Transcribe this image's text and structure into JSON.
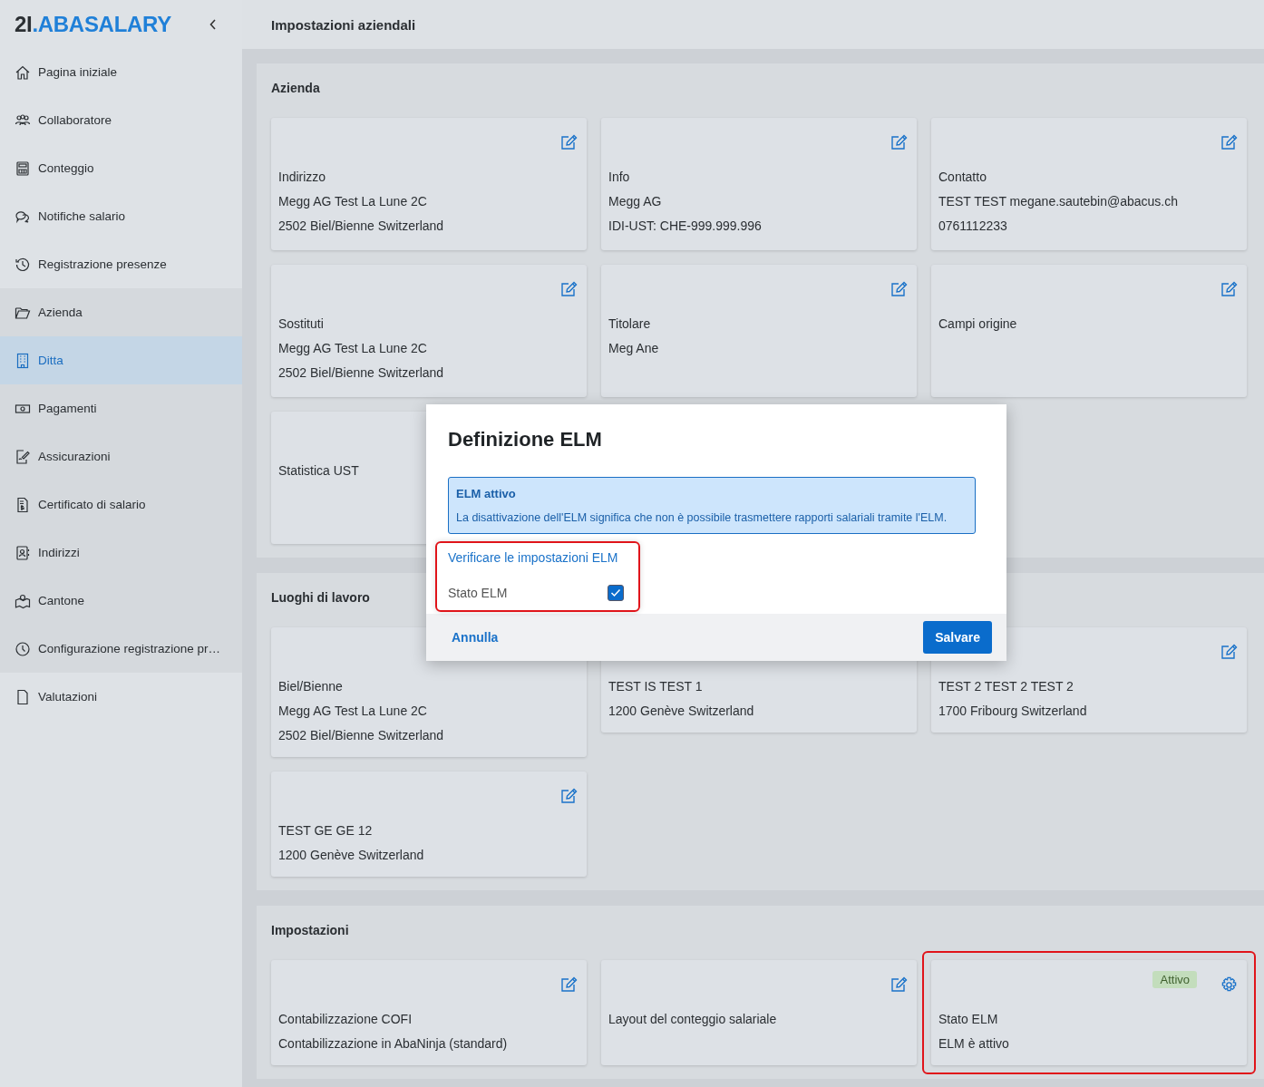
{
  "sidebar": {
    "logo": {
      "mark": "2I",
      "dot": ".",
      "name": "ABASALARY"
    },
    "items": [
      {
        "label": "Pagina iniziale",
        "selected": false
      },
      {
        "label": "Collaboratore",
        "selected": false
      },
      {
        "label": "Conteggio",
        "selected": false
      },
      {
        "label": "Notifiche salario",
        "selected": false
      },
      {
        "label": "Registrazione presenze",
        "selected": false
      },
      {
        "label": "Azienda",
        "selected": false,
        "expanded": true,
        "children": [
          {
            "label": "Ditta",
            "selected": true
          },
          {
            "label": "Pagamenti",
            "selected": false
          },
          {
            "label": "Assicurazioni",
            "selected": false
          },
          {
            "label": "Certificato di salario",
            "selected": false
          },
          {
            "label": "Indirizzi",
            "selected": false
          },
          {
            "label": "Cantone",
            "selected": false
          },
          {
            "label": "Configurazione registrazione pr…",
            "selected": false
          }
        ]
      },
      {
        "label": "Valutazioni",
        "selected": false
      }
    ]
  },
  "header": {
    "title": "Impostazioni aziendali"
  },
  "sections": [
    {
      "title": "Azienda",
      "cards": [
        {
          "kind": "editable",
          "lines": [
            "Indirizzo",
            "Megg AG Test  La Lune 2C",
            "2502 Biel/Bienne  Switzerland"
          ]
        },
        {
          "kind": "editable",
          "lines": [
            "Info",
            "Megg AG",
            "IDI-UST: CHE-999.999.996"
          ]
        },
        {
          "kind": "editable",
          "lines": [
            "Contatto",
            "TEST TEST  megane.sautebin@abacus.ch",
            "0761112233"
          ]
        },
        {
          "kind": "editable",
          "lines": [
            "Sostituti",
            "Megg AG Test  La Lune 2C",
            "2502 Biel/Bienne  Switzerland"
          ]
        },
        {
          "kind": "editable",
          "lines": [
            "Titolare",
            "Meg Ane"
          ]
        },
        {
          "kind": "editable",
          "lines": [
            "Campi origine"
          ]
        },
        {
          "kind": "plain",
          "lines": [
            "Statistica UST"
          ]
        }
      ]
    },
    {
      "title": "Luoghi di lavoro",
      "cards": [
        {
          "kind": "plain",
          "lines": [
            "Biel/Bienne",
            "Megg AG Test  La Lune 2C",
            "2502 Biel/Bienne  Switzerland"
          ]
        },
        {
          "kind": "plain",
          "lines": [
            "TEST IS  TEST 1",
            "1200 Genève  Switzerland"
          ]
        },
        {
          "kind": "editable",
          "lines": [
            "TEST 2  TEST 2 TEST 2",
            "1700 Fribourg  Switzerland"
          ]
        },
        {
          "kind": "editable",
          "lines": [
            "TEST GE  GE 12",
            "1200 Genève  Switzerland"
          ]
        }
      ]
    },
    {
      "title": "Impostazioni",
      "cards": [
        {
          "kind": "editable",
          "lines": [
            "Contabilizzazione COFI",
            "Contabilizzazione in AbaNinja (standard)"
          ]
        },
        {
          "kind": "editable",
          "lines": [
            "Layout del conteggio salariale"
          ]
        },
        {
          "kind": "configurable",
          "badge": "Attivo",
          "highlighted": true,
          "lines": [
            "Stato ELM",
            "ELM è attivo"
          ]
        }
      ]
    }
  ],
  "dialog": {
    "title": "Definizione ELM",
    "info": {
      "title": "ELM attivo",
      "text": "La disattivazione dell'ELM significa che non è possibile trasmettere rapporti salariali tramite l'ELM."
    },
    "highlighted": true,
    "link": "Verificare le impostazioni ELM",
    "field": {
      "label": "Stato ELM",
      "checked": true
    },
    "cancel": "Annulla",
    "save": "Salvare"
  }
}
